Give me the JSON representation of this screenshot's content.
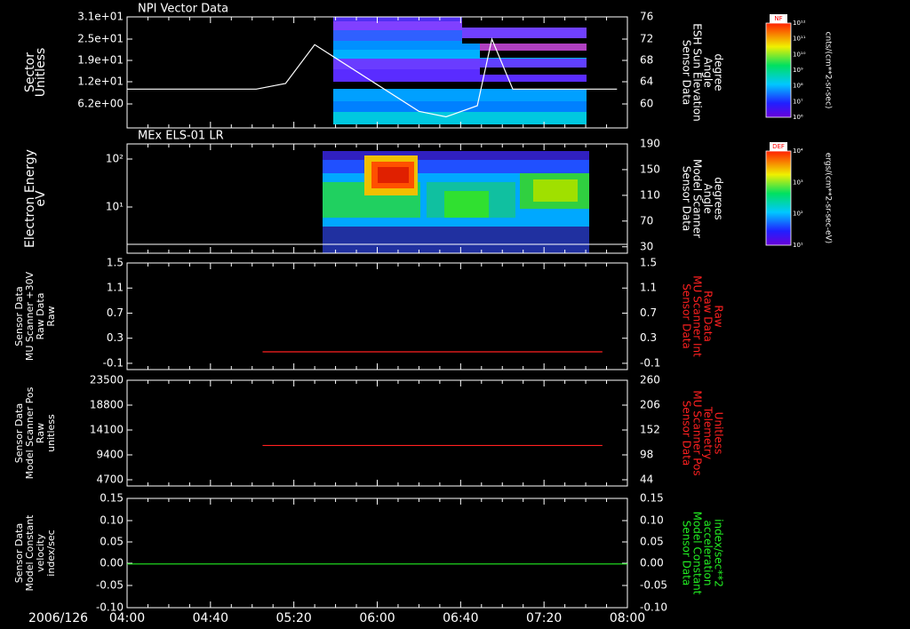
{
  "date": "2006/126",
  "time_ticks": [
    "04:00",
    "04:40",
    "05:20",
    "06:00",
    "06:40",
    "07:20",
    "08:00"
  ],
  "panels": [
    {
      "title": "NPI Vector Data",
      "left_label": [
        "Sector",
        "Unitless"
      ],
      "right_label": [
        "Sensor Data",
        "ESH Sun Elevation",
        "Angle",
        "degree"
      ],
      "left_ticks": [
        "3.1e+01",
        "2.5e+01",
        "1.9e+01",
        "1.2e+01",
        "6.2e+00"
      ],
      "right_ticks": [
        "76",
        "72",
        "68",
        "64",
        "60"
      ]
    },
    {
      "title": "MEx ELS-01 LR",
      "left_label": [
        "Electron Energy",
        "eV"
      ],
      "right_label": [
        "Sensor Data",
        "Model Scanner",
        "Angle",
        "degrees"
      ],
      "left_ticks": [
        "10²",
        "10¹"
      ],
      "right_ticks": [
        "190",
        "150",
        "110",
        "70",
        "30"
      ]
    },
    {
      "title": "",
      "left_label": [
        "Sensor Data",
        "MU Scanner +30V",
        "Raw Data",
        "Raw"
      ],
      "right_label": [
        "Sensor Data",
        "MU Scanner Int",
        "Raw Data",
        "Raw"
      ],
      "left_ticks": [
        "1.5",
        "1.1",
        "0.7",
        "0.3",
        "-0.1"
      ],
      "right_ticks": [
        "1.5",
        "1.1",
        "0.7",
        "0.3",
        "-0.1"
      ]
    },
    {
      "title": "",
      "left_label": [
        "Sensor Data",
        "Model Scanner Pos",
        "Raw",
        "unitless"
      ],
      "right_label": [
        "Sensor Data",
        "MU Scanner Pos",
        "Telemetry",
        "Unitless"
      ],
      "left_ticks": [
        "23500",
        "18800",
        "14100",
        "9400",
        "4700"
      ],
      "right_ticks": [
        "260",
        "206",
        "152",
        "98",
        "44"
      ]
    },
    {
      "title": "",
      "left_label": [
        "Sensor Data",
        "Model Constant",
        "velocity",
        "index/sec"
      ],
      "right_label": [
        "Sensor Data",
        "Model Constant",
        "acceleration",
        "index/sec**2"
      ],
      "left_ticks": [
        "0.15",
        "0.10",
        "0.05",
        "0.00",
        "-0.05",
        "-0.10"
      ],
      "right_ticks": [
        "0.15",
        "0.10",
        "0.05",
        "0.00",
        "-0.05",
        "-0.10"
      ]
    }
  ],
  "colorbars": [
    {
      "title": "NF",
      "unit": "cnts/(cm**2-sr-sec)",
      "ticks": [
        "10¹²",
        "10¹¹",
        "10¹⁰",
        "10⁹",
        "10⁸",
        "10⁷",
        "10⁶"
      ]
    },
    {
      "title": "DEF",
      "unit": "ergs/(cm**2-sr-sec-eV)",
      "ticks": [
        "10⁴",
        "10³",
        "10²",
        "10¹"
      ]
    }
  ],
  "colors": {
    "line_white": "#ffffff",
    "line_red": "#ff2020",
    "line_green": "#22ee22",
    "axis": "#ffffff"
  },
  "chart_data": [
    {
      "type": "line",
      "title": "NPI Vector Data",
      "x": [
        "04:00",
        "05:02",
        "05:16",
        "05:30",
        "06:20",
        "06:33",
        "06:48",
        "06:55",
        "07:05",
        "07:10",
        "07:55"
      ],
      "series": [
        {
          "values": [
            63,
            63,
            64,
            71,
            59,
            58,
            60,
            72,
            63,
            63,
            63
          ]
        }
      ],
      "ylim": [
        56,
        76
      ],
      "y2_axis": "Sensor Data ESH Sun Elevation Angle degree"
    },
    {
      "type": "heatmap",
      "title": "MEx ELS-01 LR",
      "xlabel": "",
      "ylabel": "Electron Energy eV",
      "scale": "log",
      "extent_time": [
        "05:40",
        "07:55"
      ],
      "note_time": [
        "05:40",
        "07:55"
      ]
    },
    {
      "type": "line",
      "x": [
        "05:05",
        "07:48"
      ],
      "series": [
        {
          "values": [
            0.0,
            0.0
          ]
        }
      ],
      "ylim": [
        -0.3,
        1.5
      ]
    },
    {
      "type": "line",
      "x": [
        "05:05",
        "07:48"
      ],
      "series": [
        {
          "values": [
            9000,
            9000
          ]
        }
      ],
      "ylim": [
        0,
        23500
      ]
    },
    {
      "type": "line",
      "x": [
        "04:00",
        "08:00"
      ],
      "series": [
        {
          "values": [
            0.0,
            0.0
          ]
        }
      ],
      "ylim": [
        -0.1,
        0.15
      ]
    }
  ]
}
